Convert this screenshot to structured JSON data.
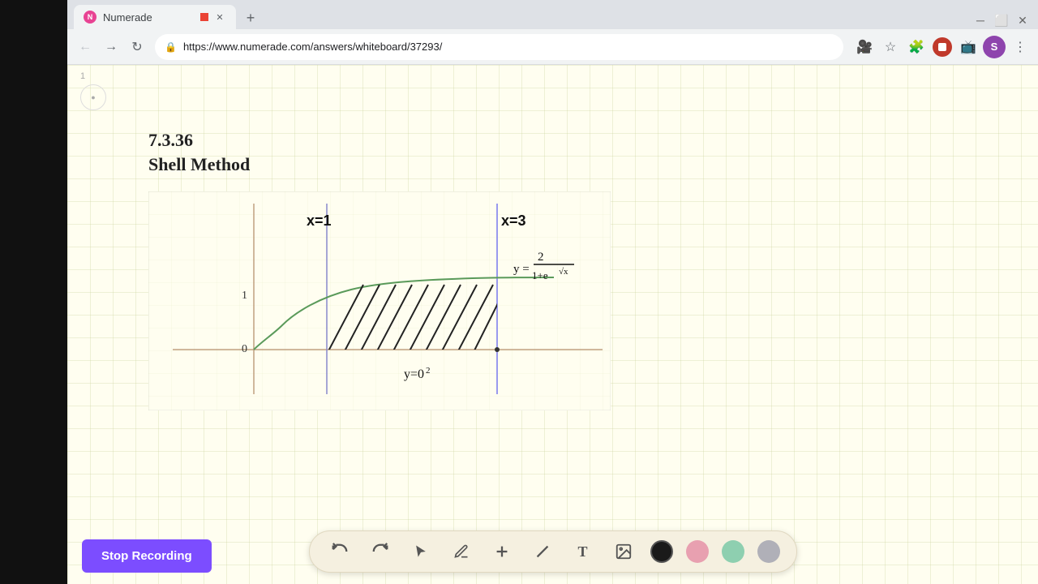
{
  "browser": {
    "tab_title": "Numerade",
    "tab_favicon": "N",
    "url": "https://www.numerade.com/answers/whiteboard/37293/",
    "new_tab_label": "+",
    "nav": {
      "back": "←",
      "forward": "→",
      "reload": "↺"
    },
    "profile_letter": "S"
  },
  "page": {
    "page_number": "1",
    "problem_number": "7.3.36",
    "problem_title": "Shell Method"
  },
  "graph": {
    "x_label1": "x=1",
    "x_label2": "x=3",
    "y_label": "y=0²",
    "function_label": "y = 2/(1+e^(√x))",
    "y_axis_mark": "1",
    "x_axis_mark": "0"
  },
  "toolbar": {
    "stop_recording_label": "Stop Recording",
    "tools": {
      "undo": "↺",
      "redo": "↻",
      "select": "▶",
      "pencil": "✏",
      "plus": "+",
      "eraser": "/",
      "text": "T",
      "image": "🖼"
    },
    "colors": {
      "black": "#1a1a1a",
      "pink": "#e8a0b0",
      "teal": "#8ecfb0",
      "gray": "#b0b0b8"
    }
  }
}
